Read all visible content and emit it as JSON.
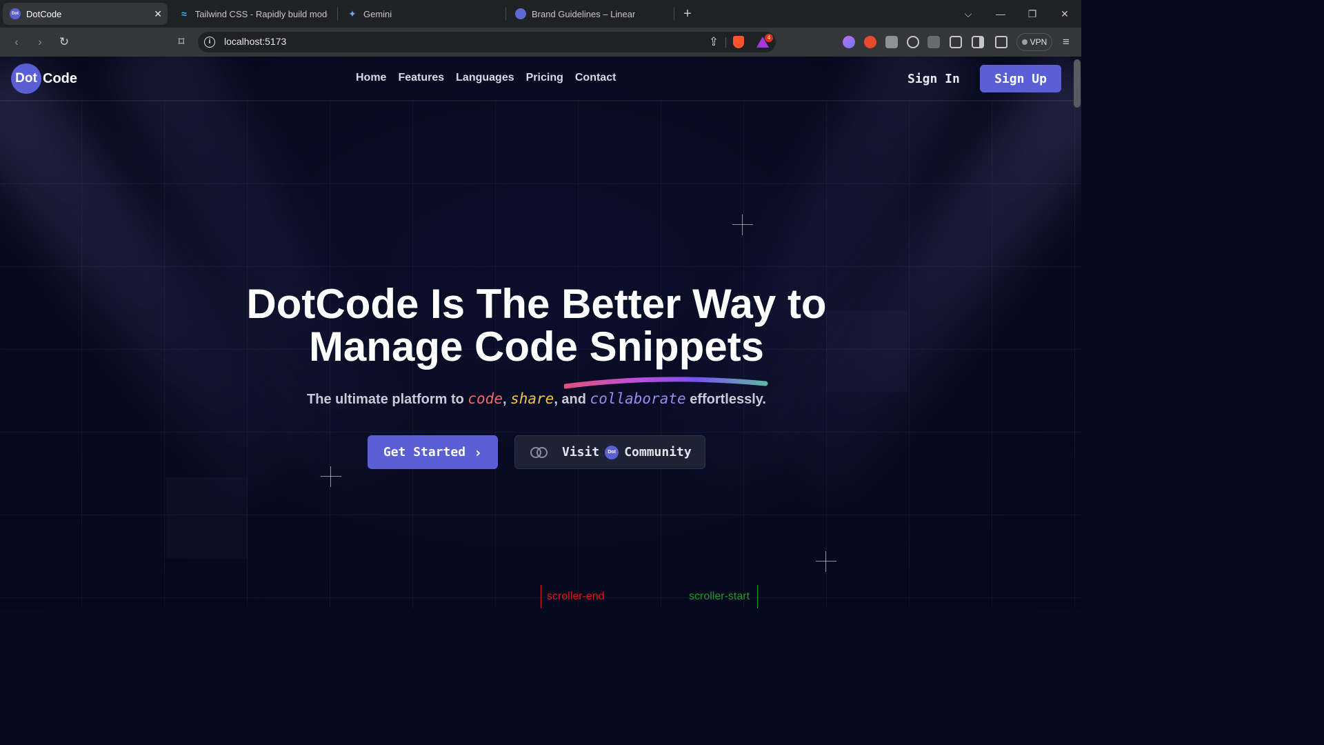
{
  "browser": {
    "tabs": [
      {
        "title": "DotCode",
        "favicon_text": "Dot",
        "active": true
      },
      {
        "title": "Tailwind CSS - Rapidly build modern",
        "active": false
      },
      {
        "title": "Gemini",
        "active": false
      },
      {
        "title": "Brand Guidelines – Linear",
        "active": false
      }
    ],
    "new_tab": "+",
    "url": "localhost:5173",
    "vpn_label": "VPN",
    "notification_count": "4",
    "icons": [
      "back-icon",
      "forward-icon",
      "reload-icon",
      "bookmark-icon",
      "share-icon",
      "brave-shield-icon",
      "brave-rewards-icon",
      "extensions-icon",
      "sidebar-icon",
      "wallet-icon",
      "menu-icon"
    ]
  },
  "site": {
    "logo": {
      "dot": "Dot",
      "code": "Code"
    },
    "nav": [
      "Home",
      "Features",
      "Languages",
      "Pricing",
      "Contact"
    ],
    "sign_in": "Sign In",
    "sign_up": "Sign Up",
    "colors": {
      "accent": "#5b5fd6",
      "background": "#070a1f",
      "code": "#f16b6b",
      "share": "#f2c14e",
      "collaborate": "#9f87f2"
    }
  },
  "hero": {
    "title_line1": "DotCode Is The Better Way to",
    "title_line2": "Manage Code Snippets",
    "sub_prefix": "The ultimate platform to",
    "sub_code": "code",
    "sub_comma": ",",
    "sub_share": "share",
    "sub_and": ", and",
    "sub_collab": "collaborate",
    "sub_suffix": "effortlessly.",
    "cta_primary": "Get Started",
    "cta_secondary_visit": "Visit",
    "cta_secondary_dot": "Dot",
    "cta_secondary_community": "Community"
  },
  "debug_markers": {
    "end": "scroller-end",
    "start": "scroller-start"
  }
}
